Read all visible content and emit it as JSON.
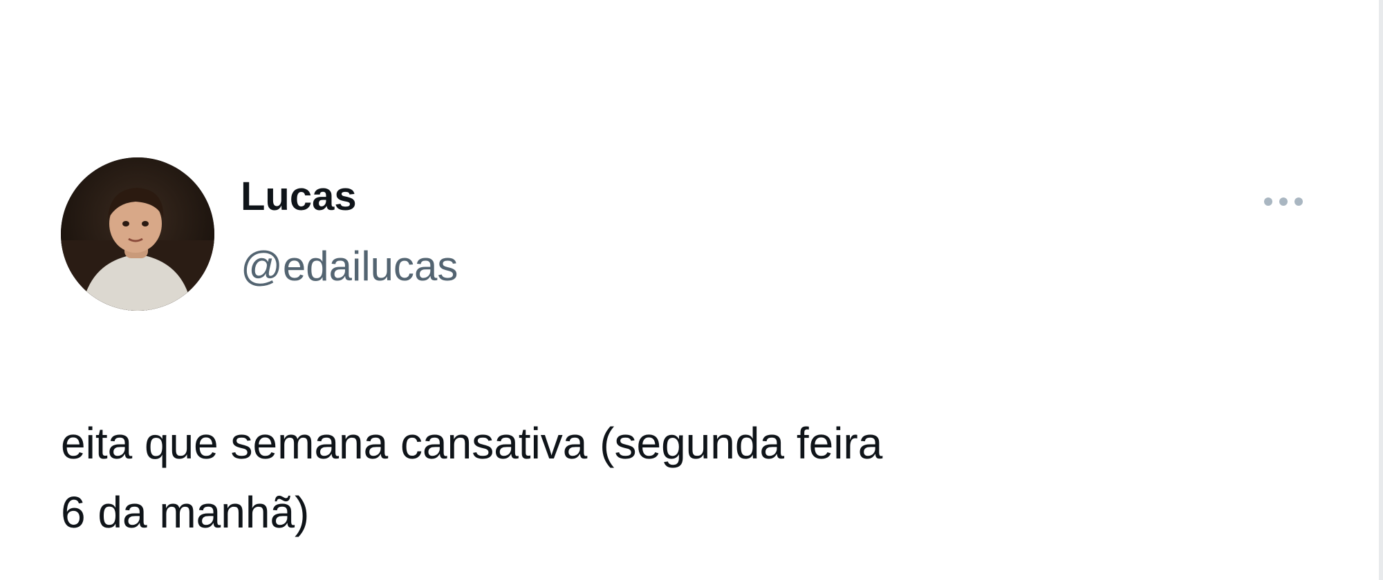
{
  "tweet": {
    "author": {
      "display_name": "Lucas",
      "handle": "@edailucas",
      "avatar_icon": "user-avatar-photo"
    },
    "text": "eita que semana cansativa (segunda feira\n6 da manhã)",
    "more_icon": "ellipsis-icon"
  },
  "colors": {
    "text_primary": "#0f1419",
    "text_secondary": "#536471",
    "icon_muted": "#a9b6c1",
    "background": "#ffffff"
  }
}
